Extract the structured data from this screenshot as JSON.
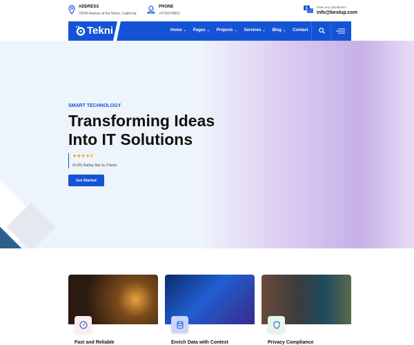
{
  "topbar": {
    "address": {
      "label": "ADDRESS",
      "value": "70240 Avenue of the Moon, California"
    },
    "phone": {
      "label": "PHONE",
      "value": "+4733378901"
    },
    "contact": {
      "question": "Have any Questions?",
      "email": "info@bestup.com"
    }
  },
  "nav": {
    "logo": "Tekni",
    "items": [
      {
        "label": "Home",
        "chevron": "⌄"
      },
      {
        "label": "Pages",
        "chevron": "⌄"
      },
      {
        "label": "Projects",
        "chevron": "⌄"
      },
      {
        "label": "Services",
        "chevron": "⌄"
      },
      {
        "label": "Blog",
        "chevron": "⌄"
      },
      {
        "label": "Contact"
      }
    ]
  },
  "hero": {
    "eyebrow": "SMART TECHNOLOGY",
    "title_line1": "Transforming Ideas",
    "title_line2": "Into IT Solutions",
    "stars": "★★★★⯪",
    "rating_value": 4.5,
    "rating_text": "(4,5/5) Rating Star by Clients",
    "cta": "Get Started"
  },
  "features": [
    {
      "title": "Fast and Reliable",
      "icon": "speedometer-icon"
    },
    {
      "title": "Enrich Data with Context",
      "icon": "database-icon"
    },
    {
      "title": "Privacy Compliance",
      "icon": "shield-icon"
    }
  ],
  "colors": {
    "brand": "#1553d6",
    "star": "#f39c12"
  }
}
